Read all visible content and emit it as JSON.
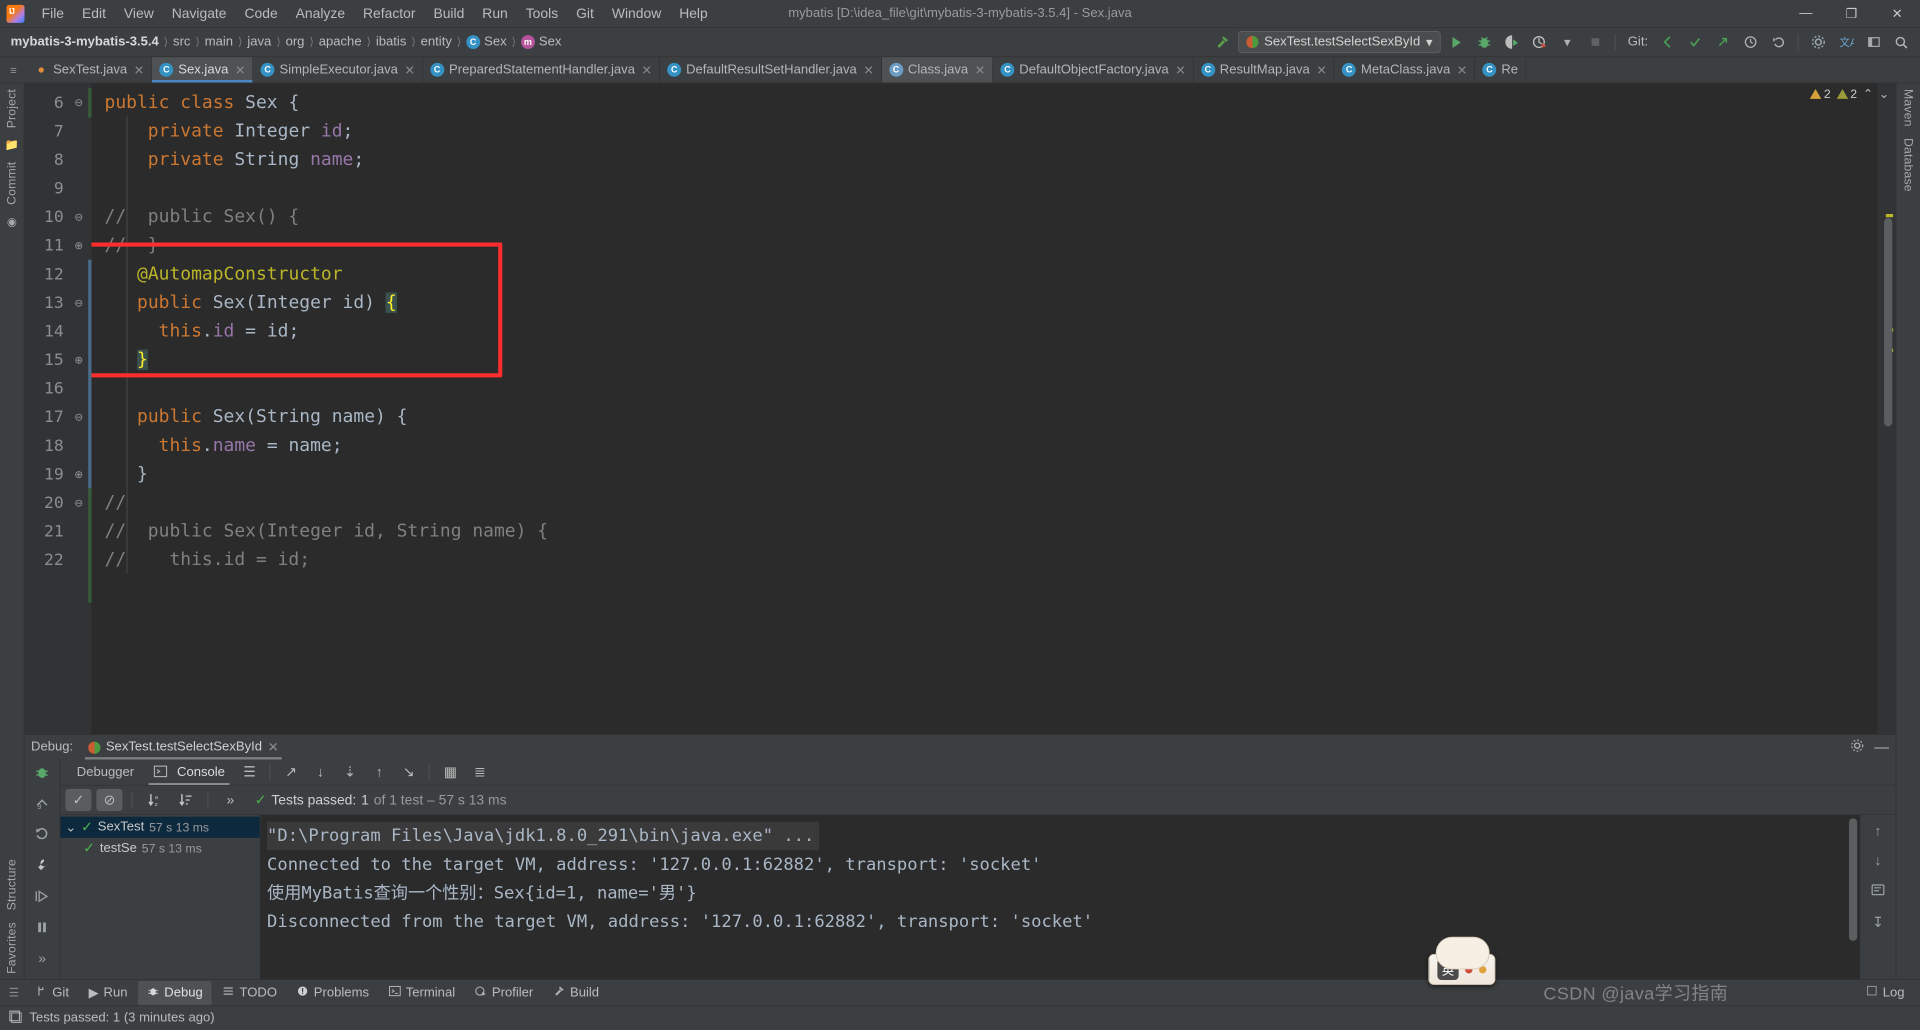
{
  "window": {
    "title": "mybatis [D:\\idea_file\\git\\mybatis-3-mybatis-3.5.4] - Sex.java",
    "minimize": "—",
    "maximize": "❐",
    "close": "✕"
  },
  "menu": [
    "File",
    "Edit",
    "View",
    "Navigate",
    "Code",
    "Analyze",
    "Refactor",
    "Build",
    "Run",
    "Tools",
    "Git",
    "Window",
    "Help"
  ],
  "breadcrumbs": [
    {
      "label": "mybatis-3-mybatis-3.5.4",
      "bold": true
    },
    {
      "label": "src"
    },
    {
      "label": "main"
    },
    {
      "label": "java"
    },
    {
      "label": "org"
    },
    {
      "label": "apache"
    },
    {
      "label": "ibatis"
    },
    {
      "label": "entity"
    },
    {
      "label": "Sex",
      "icon": "class-icon",
      "icon_letter": "C"
    },
    {
      "label": "Sex",
      "icon": "method-icon",
      "icon_letter": "m"
    }
  ],
  "toolbar": {
    "build_icon": "hammer-icon",
    "run_config": "SexTest.testSelectSexById",
    "run_config_caret": "▾",
    "run_icon": "▶",
    "debug_icon": "bug-icon",
    "run_coverage_icon": "coverage-icon",
    "profiler_icon": "profiler-icon",
    "profiler_caret": "▾",
    "stop_icon": "■",
    "git_label": "Git:",
    "git_update_icon": "↙",
    "git_commit_icon": "✓",
    "git_push_icon": "↗",
    "history_icon": "↺",
    "undo_icon": "↶",
    "settings_icon": "gear-icon",
    "translate_icon": "translate-icon",
    "layout_icon": "layout-icon",
    "search_icon": "⌕"
  },
  "editor_tabs": [
    {
      "label": "SexTest.java",
      "icon": "test-class-icon",
      "active": false
    },
    {
      "label": "Sex.java",
      "icon": "class-icon",
      "active": true
    },
    {
      "label": "SimpleExecutor.java",
      "icon": "class-icon",
      "active": false
    },
    {
      "label": "PreparedStatementHandler.java",
      "icon": "class-icon",
      "active": false
    },
    {
      "label": "DefaultResultSetHandler.java",
      "icon": "class-icon",
      "active": false
    },
    {
      "label": "Class.java",
      "icon": "library-class-icon",
      "active": false
    },
    {
      "label": "DefaultObjectFactory.java",
      "icon": "class-icon",
      "active": false
    },
    {
      "label": "ResultMap.java",
      "icon": "class-icon",
      "active": false
    },
    {
      "label": "MetaClass.java",
      "icon": "class-icon",
      "active": false
    },
    {
      "label": "Re",
      "icon": "class-icon",
      "active": false
    }
  ],
  "left_stripe": [
    "Project",
    "Commit"
  ],
  "right_stripe": [
    "Maven",
    "Database"
  ],
  "inspections": {
    "warnings": "2",
    "weak_warnings": "2",
    "up_icon": "⌃",
    "down_icon": "⌄"
  },
  "code": {
    "first_line_number": 6,
    "lines": [
      {
        "n": 6,
        "fold": "⊖",
        "tokens": [
          {
            "t": "public ",
            "c": "k"
          },
          {
            "t": "class ",
            "c": "k"
          },
          {
            "t": "Sex",
            "c": "cls"
          },
          {
            "t": " {",
            "c": "t"
          }
        ],
        "indent": 0
      },
      {
        "n": 7,
        "fold": "",
        "tokens": [
          {
            "t": "    private ",
            "c": "k"
          },
          {
            "t": "Integer ",
            "c": "ty"
          },
          {
            "t": "id",
            "c": "fld"
          },
          {
            "t": ";",
            "c": "t"
          }
        ],
        "indent": 1
      },
      {
        "n": 8,
        "fold": "",
        "tokens": [
          {
            "t": "    private ",
            "c": "k"
          },
          {
            "t": "String ",
            "c": "ty"
          },
          {
            "t": "name",
            "c": "fld"
          },
          {
            "t": ";",
            "c": "t"
          }
        ],
        "indent": 1
      },
      {
        "n": 9,
        "fold": "",
        "tokens": [],
        "indent": 1
      },
      {
        "n": 10,
        "fold": "⊖",
        "tokens": [
          {
            "t": "//  public Sex() {",
            "c": "cm"
          }
        ],
        "indent": 1
      },
      {
        "n": 11,
        "fold": "⊕",
        "tokens": [
          {
            "t": "//  }",
            "c": "cm"
          }
        ],
        "indent": 1
      },
      {
        "n": 12,
        "fold": "",
        "tokens": [
          {
            "t": "    @AutomapConstructor",
            "c": "an"
          }
        ],
        "indent": 1
      },
      {
        "n": 13,
        "fold": "⊖",
        "tokens": [
          {
            "t": "    public ",
            "c": "k"
          },
          {
            "t": "Sex",
            "c": "cls"
          },
          {
            "t": "(",
            "c": "t"
          },
          {
            "t": "Integer",
            "c": "ty"
          },
          {
            "t": " id",
            "c": "t"
          },
          {
            "t": ") ",
            "c": "t"
          },
          {
            "t": "{",
            "c": "brace-hl"
          }
        ],
        "indent": 1
      },
      {
        "n": 14,
        "fold": "",
        "tokens": [
          {
            "t": "      this",
            "c": "k"
          },
          {
            "t": ".",
            "c": "t"
          },
          {
            "t": "id",
            "c": "fld"
          },
          {
            "t": " = id;",
            "c": "t"
          }
        ],
        "indent": 2
      },
      {
        "n": 15,
        "fold": "⊕",
        "tokens": [
          {
            "t": "    }",
            "c": "brace-hl"
          }
        ],
        "indent": 1
      },
      {
        "n": 16,
        "fold": "",
        "tokens": [],
        "indent": 1
      },
      {
        "n": 17,
        "fold": "⊖",
        "tokens": [
          {
            "t": "    public ",
            "c": "k"
          },
          {
            "t": "Sex",
            "c": "cls"
          },
          {
            "t": "(",
            "c": "t"
          },
          {
            "t": "String",
            "c": "ty"
          },
          {
            "t": " name",
            "c": "t"
          },
          {
            "t": ") {",
            "c": "t"
          }
        ],
        "indent": 1
      },
      {
        "n": 18,
        "fold": "",
        "tokens": [
          {
            "t": "      this",
            "c": "k"
          },
          {
            "t": ".",
            "c": "t"
          },
          {
            "t": "name",
            "c": "fld"
          },
          {
            "t": " = name;",
            "c": "t"
          }
        ],
        "indent": 2
      },
      {
        "n": 19,
        "fold": "⊕",
        "tokens": [
          {
            "t": "    }",
            "c": "t"
          }
        ],
        "indent": 1
      },
      {
        "n": 20,
        "fold": "⊖",
        "tokens": [
          {
            "t": "//",
            "c": "cm"
          }
        ],
        "indent": 1
      },
      {
        "n": 21,
        "fold": "",
        "tokens": [
          {
            "t": "//  public Sex(Integer id, String name) {",
            "c": "cm"
          }
        ],
        "indent": 1
      },
      {
        "n": 22,
        "fold": "",
        "tokens": [
          {
            "t": "//    this.id = id;",
            "c": "cm"
          }
        ],
        "indent": 1
      }
    ]
  },
  "debug": {
    "label": "Debug:",
    "session_tab": "SexTest.testSelectSexById",
    "session_close": "✕",
    "settings_icon": "gear-icon",
    "hide_icon": "—",
    "tabs": [
      {
        "label": "Debugger",
        "active": false,
        "icon": ""
      },
      {
        "label": "Console",
        "active": true,
        "icon": "console-icon"
      }
    ],
    "tab_toolbar_icons": [
      "layout-icon",
      "step-over-icon",
      "step-into-icon",
      "force-step-into-icon",
      "step-out-icon",
      "run-to-cursor-icon",
      "evaluate-icon",
      "threads-icon"
    ],
    "left_icons": [
      "bug-icon",
      "mute-breakpoints-icon",
      "restart-icon",
      "settings-wrench-icon",
      "resume-icon",
      "pause-icon",
      "more-icon"
    ],
    "toggles": {
      "show_passed": "✓",
      "show_ignored": "⊘",
      "sort_alpha": "sort-alpha-icon",
      "sort_duration": "sort-duration-icon",
      "more": "»"
    },
    "summary": {
      "prefix": "Tests passed:",
      "count": "1",
      "suffix": "of 1 test – 57 s 13 ms"
    },
    "tree": [
      {
        "label": "SexTest",
        "time": "57 s 13 ms",
        "selected": true,
        "depth": 0,
        "expander": "⌄",
        "status": "✓"
      },
      {
        "label": "testSe",
        "time": "57 s 13 ms",
        "selected": false,
        "depth": 1,
        "expander": "",
        "status": "✓"
      }
    ],
    "console_lines": [
      {
        "text": "\"D:\\Program Files\\Java\\jdk1.8.0_291\\bin\\java.exe\" ...",
        "highlight": true
      },
      {
        "text": "Connected to the target VM, address: '127.0.0.1:62882', transport: 'socket'",
        "highlight": false
      },
      {
        "text": "使用MyBatis查询一个性别：Sex{id=1, name='男'}",
        "highlight": false
      },
      {
        "text": "Disconnected from the target VM, address: '127.0.0.1:62882', transport: 'socket'",
        "highlight": false
      }
    ],
    "console_right_icons": [
      "scroll-up-icon",
      "scroll-down-icon",
      "soft-wrap-icon",
      "scroll-end-icon"
    ]
  },
  "bottom_tools": [
    {
      "label": "Git",
      "icon": "branch-icon",
      "active": false
    },
    {
      "label": "Run",
      "icon": "▶",
      "active": false
    },
    {
      "label": "Debug",
      "icon": "bug-icon",
      "active": true
    },
    {
      "label": "TODO",
      "icon": "list-icon",
      "active": false
    },
    {
      "label": "Problems",
      "icon": "error-icon",
      "active": false
    },
    {
      "label": "Terminal",
      "icon": "terminal-icon",
      "active": false
    },
    {
      "label": "Profiler",
      "icon": "profiler-icon",
      "active": false
    },
    {
      "label": "Build",
      "icon": "hammer-icon",
      "active": false
    }
  ],
  "bottom_right_tools": [
    {
      "label": "Log",
      "icon": "log-icon"
    }
  ],
  "status": {
    "icon": "event-log-icon",
    "message": "Tests passed: 1 (3 minutes ago)"
  },
  "structure_stripe": [
    "Structure",
    "Favorites"
  ],
  "ime": {
    "lang": "英",
    "tooltip": ""
  },
  "watermark": "CSDN @java学习指南",
  "colors": {
    "accent_blue": "#4a88c7",
    "keyword_orange": "#cc7832",
    "annotation_yellow": "#bbb529",
    "field_purple": "#9876aa",
    "comment_gray": "#808080",
    "highlight_red": "#ff2d2d",
    "success_green": "#4caf50",
    "editor_bg": "#2b2b2b",
    "chrome_bg": "#3c3f41"
  }
}
